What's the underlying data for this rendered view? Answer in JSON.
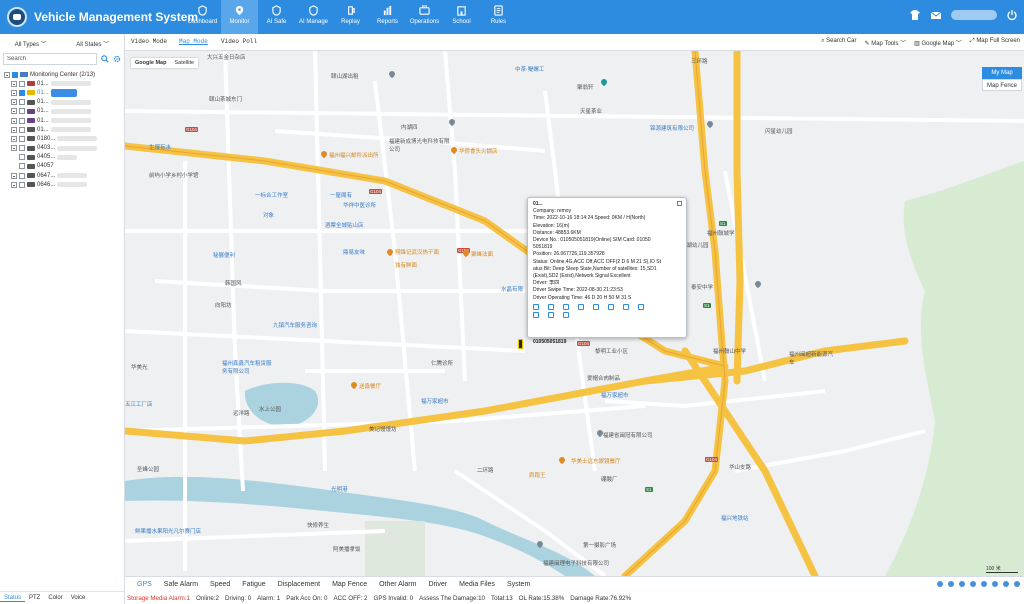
{
  "header": {
    "title": "Vehicle Management System",
    "nav": [
      {
        "label": "Dashboard",
        "icon": "dashboard-icon"
      },
      {
        "label": "Monitor",
        "icon": "monitor-icon",
        "active": true
      },
      {
        "label": "AI Safe",
        "icon": "ai-safe-icon"
      },
      {
        "label": "AI Manage",
        "icon": "ai-manage-icon"
      },
      {
        "label": "Replay",
        "icon": "replay-icon"
      },
      {
        "label": "Reports",
        "icon": "reports-icon"
      },
      {
        "label": "Operations",
        "icon": "operations-icon"
      },
      {
        "label": "School",
        "icon": "school-icon"
      },
      {
        "label": "Rules",
        "icon": "rules-icon"
      }
    ],
    "right_icons": [
      "shirt-icon",
      "mail-icon",
      "user-icon",
      "power-icon"
    ]
  },
  "left": {
    "filter_types": "All Types",
    "filter_states": "All States",
    "search_placeholder": "Search",
    "tree_root": "Monitoring Center  (2/13)",
    "vehicles": [
      "01...",
      "01...",
      "01...",
      "01...",
      "01...",
      "01...",
      "0180...",
      "0403...",
      "0405...",
      "04057",
      "0647...",
      "0646..."
    ],
    "tabs": [
      "Status",
      "PTZ",
      "Color",
      "Voice"
    ]
  },
  "modebar": {
    "tabs": [
      "Video Mode",
      "Map Mode",
      "Video Poll"
    ],
    "tools": [
      "Search Car",
      "Map Tools",
      "Google Map",
      "Map Full Screen"
    ]
  },
  "map": {
    "type_tabs": [
      "Google Map",
      "Satellite"
    ],
    "buttons": {
      "my_map": "My Map",
      "map_fence": "Map Fence"
    },
    "scale": "100 米",
    "labels": {
      "l1": "大兴五金日杂店",
      "l2": "颐山湖出租",
      "l3": "颐山茶城东门",
      "l4": "中茶·鳀螺工",
      "l5": "聚翁轩",
      "l6": "天星茶业",
      "l7": "锦源建筑有限公司",
      "l8": "内湖四",
      "l9": "闪星幼儿园",
      "l10": "福建新成博光电科技有限公司",
      "l11": "福州福兴邮件派出所",
      "l12": "华侨食头火锅店",
      "l13": "生爆有水",
      "l14": "前屿小学乡村小学馆",
      "l15": "一标合工作室",
      "l16": "一屋阁有",
      "l17": "华祥中医诊所",
      "l18": "对象",
      "l19": "酒票全城贴山店",
      "l20": "荔湖幼儿园",
      "l21": "秘展便利",
      "l22": "鼎易友味",
      "l23": "翔锋记武汉热干面",
      "l24": "聚峰法面",
      "l25": "独有鲜面",
      "l26": "水晶有限",
      "l27": "泰安中学",
      "l28": "韩国风",
      "l29": "向阳坊",
      "l30": "九镇汽车服务咨询",
      "l31": "福州鑫鑫汽车租赁服务有限公司",
      "l32": "华美光",
      "l33": "仁腾诊所",
      "l34": "福万家超市",
      "l35": "福州鼓山中学",
      "l36": "送鑫餐厅",
      "l37": "美记馒馒坊",
      "l38": "二环路",
      "l39": "远洋路",
      "l40": "三环路",
      "l41": "圣峰公园",
      "l42": "华美士远东眼镜餐厅",
      "l43": "肩跑王",
      "l44": "光明港",
      "l45": "快修养生",
      "l46": "阿美播拿饭",
      "l47": "福州闽超新能源汽车",
      "l48": "福兴地铁站",
      "l49": "福建闽理电子科技有限公司",
      "l50": "爱帽合肉制品",
      "l51": "福万家超市",
      "l52": "黎明工业小区",
      "l53": "水上公园",
      "l54": "五江工厂店",
      "l55": "鲜果播水果阳光凡尔赛门店",
      "l56": "第一摄影广场",
      "l57": "福建省闽冠有限公司",
      "l58": "福州鼓城学",
      "l59": "硼酸厂",
      "l60": "华山支路"
    },
    "road_tags": [
      "G104",
      "G104",
      "G104",
      "G104",
      "G104",
      "S1",
      "S1",
      "S1"
    ]
  },
  "popup": {
    "title": "01...",
    "company": "Company: remoy",
    "time": "Time:  2022-10-16 18:14:24    Speed:  0KM / H(North)",
    "elevation": "Elevation:  16(m)",
    "distance": "Distance:  48853.6KM",
    "device": "Device No.:  010505051819(Online)    SIM Card:  01050",
    "device2": "5051819",
    "position": "Position: 26.067726,119.357928",
    "status": "Status:  Online,4G,ACC Off,ACC OFF(2 D 6 M 21 S),IO St",
    "status2": "atus Bit:  Deep Sleep State,Number of satellites:  15,SD1",
    "status3": "(Exist),SD2 (Exist),Network Signal Excellent",
    "driver": "Driver: 李四",
    "swipe": "Driver Swipe Time:  2022-08-30 21:23:53",
    "operating": "Driver Operating Time:  46 D 20 H 50 M 31 S",
    "vehicle_label": "010505051819"
  },
  "bottom": {
    "tabs": [
      "GPS",
      "Safe Alarm",
      "Speed",
      "Fatigue",
      "Displacement",
      "Map Fence",
      "Other Alarm",
      "Driver",
      "Media Files",
      "System"
    ]
  },
  "statusbar": {
    "alarm": "Storage Media Alarm:1",
    "items": [
      "Online:2",
      "Driving: 0",
      "Alarm: 1",
      "Park Acc On: 0",
      "ACC OFF: 2",
      "GPS Invalid: 0",
      "Assess The Damage:10",
      "Total:13",
      "OL Rate:15.38%",
      "Damage Rate:76.92%"
    ]
  }
}
